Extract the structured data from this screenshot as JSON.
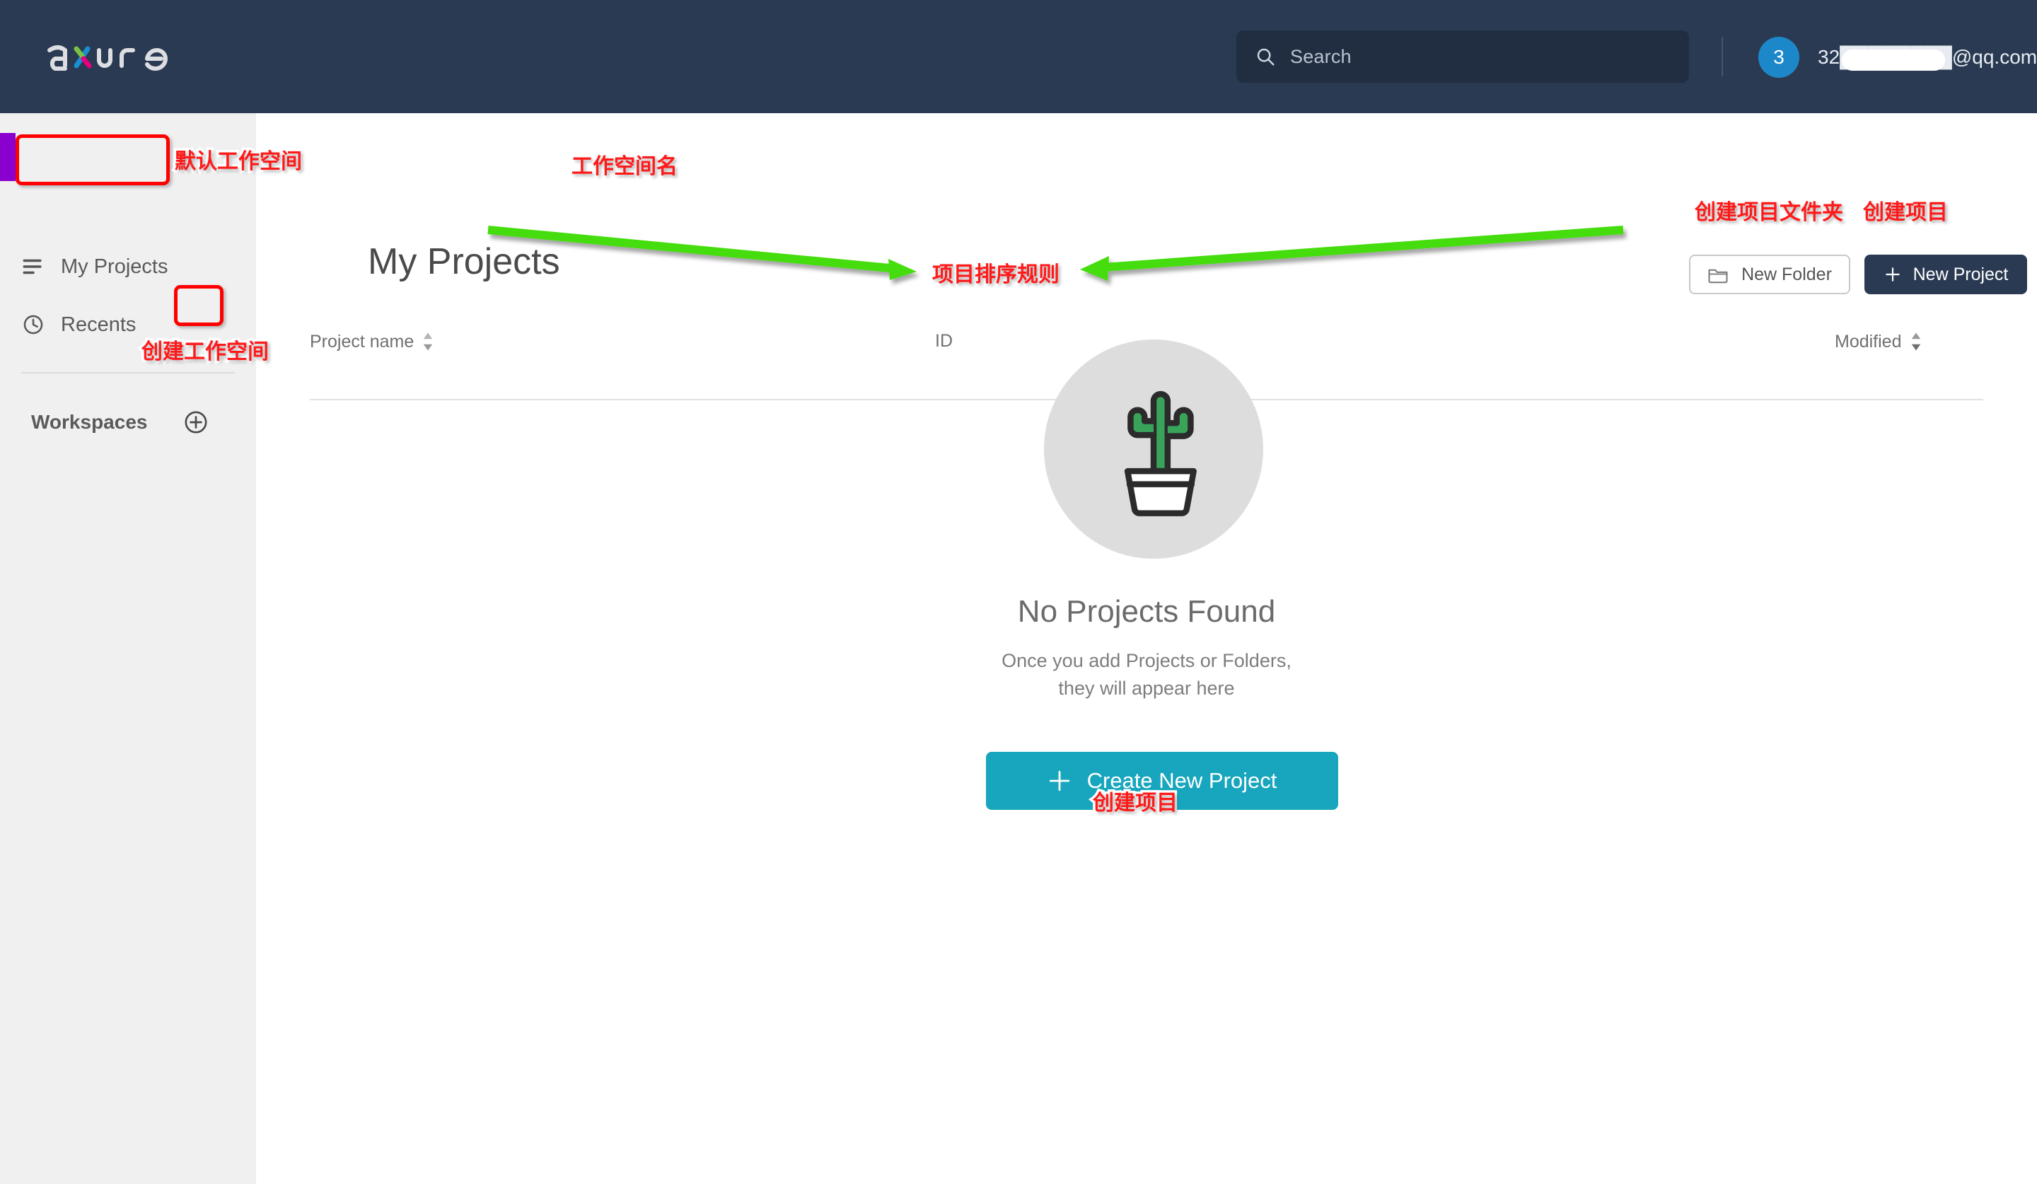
{
  "header": {
    "logo_text": "axure",
    "search": {
      "placeholder": "Search",
      "icon": "search-icon"
    },
    "account": {
      "avatar_initial": "3",
      "email": "32████████@qq.com",
      "chevron": "chevron-down-icon"
    }
  },
  "sidebar": {
    "items": [
      {
        "label": "My Projects",
        "icon": "menu-lines-icon",
        "active": true
      },
      {
        "label": "Recents",
        "icon": "clock-icon",
        "active": false
      }
    ],
    "workspaces": {
      "label": "Workspaces",
      "add_button_icon": "plus-circle-icon"
    }
  },
  "main": {
    "page_title": "My Projects",
    "toolbar": {
      "new_folder_label": "New Folder",
      "new_folder_icon": "folder-icon",
      "new_project_label": "New Project",
      "new_project_icon": "plus-icon"
    },
    "table": {
      "columns": [
        {
          "key": "project_name",
          "label": "Project name",
          "sortable": true
        },
        {
          "key": "id",
          "label": "ID",
          "sortable": false
        },
        {
          "key": "modified",
          "label": "Modified",
          "sortable": true
        }
      ],
      "rows": []
    },
    "empty_state": {
      "illustration": "cactus-in-pot-icon",
      "title": "No Projects Found",
      "subtitle_line1": "Once you add Projects or Folders,",
      "subtitle_line2": "they will appear here",
      "cta_label": "Create New Project",
      "cta_icon": "plus-icon"
    }
  },
  "annotations": {
    "default_workspace": "默认工作空间",
    "workspace_name": "工作空间名",
    "create_workspace": "创建工作空间",
    "create_project_folder": "创建项目文件夹",
    "create_project_top": "创建项目",
    "project_sort_rule": "项目排序规则",
    "create_project_cta": "创建项目"
  },
  "colors": {
    "header_bg": "#2a3a52",
    "sidebar_bg": "#f0f0f0",
    "accent_purple": "#8a00cf",
    "avatar_blue": "#1d88c9",
    "cta_teal": "#17a6bd",
    "annotation_red": "#ff0000",
    "annotation_green": "#44dd11",
    "cactus_green": "#3aa35a"
  }
}
